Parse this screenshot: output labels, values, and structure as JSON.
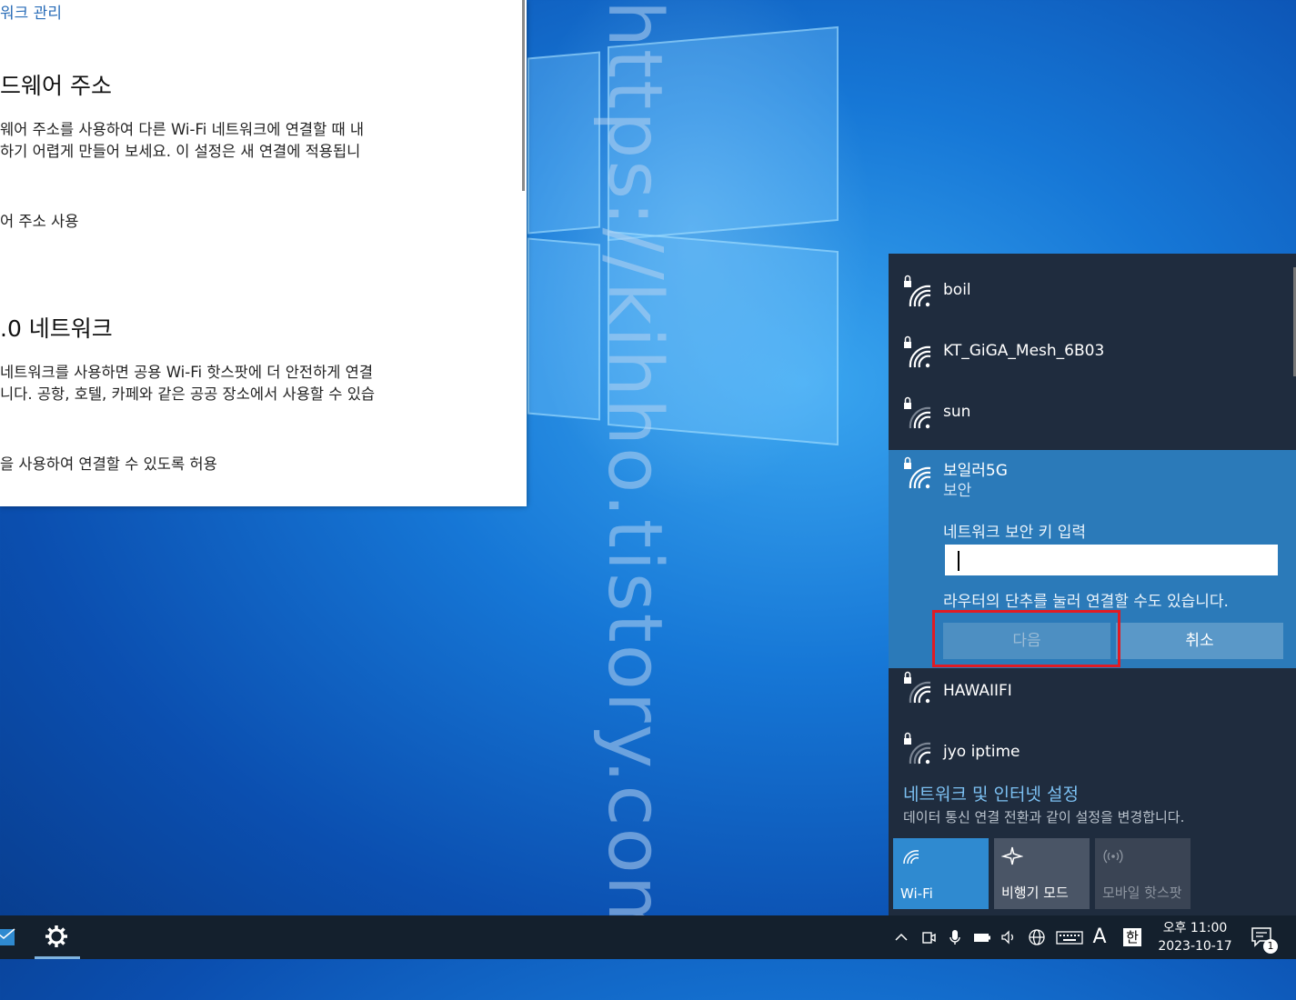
{
  "settings_window": {
    "link": "워크 관리",
    "section1_title": "드웨어 주소",
    "section1_text1": "웨어 주소를 사용하여 다른 Wi-Fi 네트워크에 연결할 때 내",
    "section1_text2": "하기 어렵게 만들어 보세요. 이 설정은 새 연결에 적용됩니",
    "section1_option": "어 주소 사용",
    "section2_title": ".0 네트워크",
    "section2_text1": "네트워크를 사용하면 공용 Wi-Fi 핫스팟에 더 안전하게 연결",
    "section2_text2": "니다. 공항, 호텔, 카페와 같은 공공 장소에서 사용할 수 있습",
    "section2_option": "을 사용하여 연결할 수 있도록 허용"
  },
  "watermark": "https://kihho.tistory.com",
  "flyout": {
    "networks": [
      {
        "name": "boil",
        "icon": "wifi-secured-icon"
      },
      {
        "name": "KT_GiGA_Mesh_6B03",
        "icon": "wifi-secured-icon"
      },
      {
        "name": "sun",
        "icon": "wifi-secured-icon"
      }
    ],
    "selected": {
      "name": "보일러5G",
      "status": "보안",
      "key_label": "네트워크 보안 키 입력",
      "key_value": "",
      "hint": "라우터의 단추를 눌러 연결할 수도 있습니다.",
      "next_label": "다음",
      "cancel_label": "취소"
    },
    "networks_after": [
      {
        "name": "HAWAIIFI",
        "icon": "wifi-secured-icon"
      },
      {
        "name": "jyo iptime",
        "icon": "wifi-secured-icon"
      }
    ],
    "settings_link": "네트워크 및 인터넷 설정",
    "settings_sub": "데이터 통신 연결 전환과 같이 설정을 변경합니다.",
    "tiles": [
      {
        "label": "Wi-Fi",
        "icon": "wifi-icon",
        "active": true
      },
      {
        "label": "비행기 모드",
        "icon": "airplane-icon",
        "active": false
      },
      {
        "label": "모바일 핫스팟",
        "icon": "hotspot-icon",
        "active": false,
        "disabled": true
      }
    ]
  },
  "taskbar": {
    "ime_a": "A",
    "ime_lang": "한",
    "clock_time": "오후 11:00",
    "clock_date": "2023-10-17",
    "notification_count": "1"
  },
  "colors": {
    "flyout_bg": "#1f2c3e",
    "selected_bg": "#2b7ab9",
    "highlight_box": "#e01b24",
    "taskbar_bg": "#14202d"
  }
}
